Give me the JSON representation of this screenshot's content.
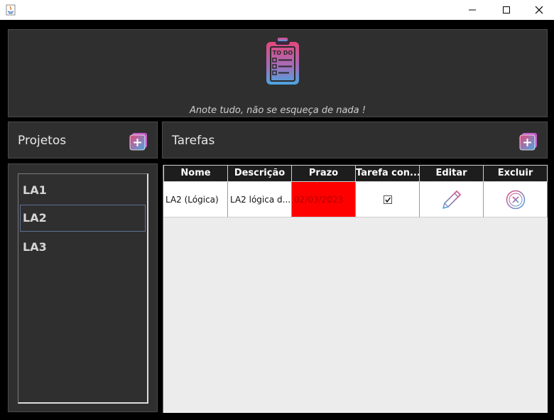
{
  "header": {
    "tagline": "Anote tudo, não se esqueça de nada !"
  },
  "projects_panel": {
    "title": "Projetos",
    "items": [
      {
        "label": "LA1",
        "selected": false
      },
      {
        "label": "LA2",
        "selected": true
      },
      {
        "label": "LA3",
        "selected": false
      }
    ]
  },
  "tasks_panel": {
    "title": "Tarefas",
    "columns": [
      "Nome",
      "Descrição",
      "Prazo",
      "Tarefa con...",
      "Editar",
      "Excluir"
    ],
    "rows": [
      {
        "nome": "LA2 (Lógica)",
        "descricao": "LA2 lógica d...",
        "prazo": "02/03/2023",
        "concluida": true
      }
    ]
  },
  "colors": {
    "deadline_overdue": "#ff0000",
    "panel": "#2f2f2f",
    "background": "#000000"
  },
  "icons": [
    "java-app-icon",
    "clipboard-todo-logo",
    "add-icon",
    "pencil-edit-icon",
    "delete-circle-icon",
    "checkbox-checked-icon"
  ]
}
